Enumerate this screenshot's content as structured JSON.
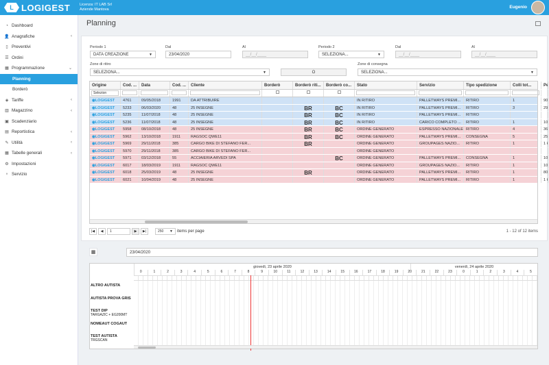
{
  "header": {
    "logo_letter": "L",
    "logo": "LOGIGEST",
    "license": "Licenza: IT LAB Srl",
    "company": "Aziende Mantova",
    "user": "Eugenio"
  },
  "sidebar": [
    {
      "label": "Dashboard",
      "icon": "dashboard-icon",
      "glyph": "◔"
    },
    {
      "label": "Anagrafiche",
      "icon": "users-icon",
      "glyph": "👤",
      "chev": "‹"
    },
    {
      "label": "Preventivi",
      "icon": "file-icon",
      "glyph": "▯"
    },
    {
      "label": "Ordini",
      "icon": "list-icon",
      "glyph": "☰"
    },
    {
      "label": "Programmazione",
      "icon": "calendar-icon",
      "glyph": "▦",
      "chev": "⌄"
    },
    {
      "label": "Planning",
      "sub": true,
      "active": true
    },
    {
      "label": "Borderò",
      "sub": true
    },
    {
      "label": "Tariffe",
      "icon": "tag-icon",
      "glyph": "◈",
      "chev": "‹"
    },
    {
      "label": "Magazzino",
      "icon": "warehouse-icon",
      "glyph": "▥",
      "chev": "‹"
    },
    {
      "label": "Scadenziario",
      "icon": "clock-icon",
      "glyph": "▣"
    },
    {
      "label": "Reportistica",
      "icon": "chart-icon",
      "glyph": "▤",
      "chev": "‹"
    },
    {
      "label": "Utilità",
      "icon": "tools-icon",
      "glyph": "✎",
      "chev": "‹"
    },
    {
      "label": "Tabelle generali",
      "icon": "table-icon",
      "glyph": "▦",
      "chev": "‹"
    },
    {
      "label": "Impostazioni",
      "icon": "settings-icon",
      "glyph": "⚙"
    },
    {
      "label": "Servizio",
      "icon": "service-icon",
      "glyph": "♆"
    }
  ],
  "page": {
    "title": "Planning"
  },
  "filters": {
    "periodo1_label": "Periodo 1",
    "periodo1_value": "DATA CREAZIONE",
    "dal1_label": "Dal",
    "dal1_value": "23/04/2020",
    "al1_label": "Al",
    "al1_value": "__/__/____",
    "periodo2_label": "Periodo 2",
    "periodo2_value": "SELEZIONA...",
    "dal2_label": "Dal",
    "dal2_value": "__/__/____",
    "al2_label": "Al",
    "al2_value": "__/__/____",
    "zone_ritiro_label": "Zone di ritiro",
    "zone_ritiro_value": "SELEZIONA...",
    "o_value": "O",
    "zone_consegna_label": "Zone di consegna",
    "zone_consegna_value": "SELEZIONA..."
  },
  "grid": {
    "columns": [
      "Origine",
      "Cod. ...",
      "Data",
      "Cod. ...",
      "Cliente",
      "Borderò",
      "Borderò riti...",
      "Borderò co...",
      "Stato",
      "Servizio",
      "Tipo spedizione",
      "Colli tot...",
      "Pe"
    ],
    "origin_filter": "Selezion",
    "rows": [
      {
        "c": "blue",
        "o": "LOGIGEST",
        "cod": "4761",
        "data": "09/05/2018",
        "cod2": "1991",
        "cli": "DA ATTRIBUIRE",
        "br": "",
        "bc": "",
        "stato": "IN RITIRO",
        "serv": "PALLETWAYS PREMI...",
        "tipo": "RITIRO",
        "colli": "1",
        "pe": "900 kg"
      },
      {
        "c": "blue",
        "o": "LOGIGEST",
        "cod": "5233",
        "data": "06/03/2020",
        "cod2": "48",
        "cli": "25 INSEGNE",
        "br": "BR",
        "bc": "BC",
        "stato": "IN RITIRO",
        "serv": "PALLETWAYS PREMI...",
        "tipo": "RITIRO",
        "colli": "3",
        "pe": "290 kg"
      },
      {
        "c": "blue",
        "o": "LOGIGEST",
        "cod": "5235",
        "data": "11/07/2018",
        "cod2": "48",
        "cli": "25 INSEGNE",
        "br": "BR",
        "bc": "BC",
        "stato": "IN RITIRO",
        "serv": "PALLETWAYS PREMI...",
        "tipo": "RITIRO",
        "colli": "",
        "pe": ""
      },
      {
        "c": "blue",
        "o": "LOGIGEST",
        "cod": "5236",
        "data": "11/07/2018",
        "cod2": "48",
        "cli": "25 INSEGNE",
        "br": "BR",
        "bc": "BC",
        "stato": "IN RITIRO",
        "serv": "CARICO COMPLETO ...",
        "tipo": "RITIRO",
        "colli": "1",
        "pe": "100 kg"
      },
      {
        "c": "red",
        "o": "LOGIGEST",
        "cod": "5958",
        "data": "08/10/2018",
        "cod2": "48",
        "cli": "25 INSEGNE",
        "br": "BR",
        "bc": "BC",
        "stato": "ORDINE GENERATO",
        "serv": "ESPRESSO NAZIONALE",
        "tipo": "RITIRO",
        "colli": "4",
        "pe": "36 kg"
      },
      {
        "c": "red",
        "o": "LOGIGEST",
        "cod": "5962",
        "data": "13/10/2018",
        "cod2": "1911",
        "cli": "RAGSOC QWE11",
        "br": "BR",
        "bc": "BC",
        "stato": "ORDINE GENERATO",
        "serv": "PALLETWAYS PREMI...",
        "tipo": "CONSEGNA",
        "colli": "5",
        "pe": "251 kg"
      },
      {
        "c": "red",
        "o": "LOGIGEST",
        "cod": "5969",
        "data": "29/11/2018",
        "cod2": "385",
        "cli": "CARGO BIKE DI STEFANO FER...",
        "br": "BR",
        "bc": "",
        "stato": "ORDINE GENERATO",
        "serv": "GROUPAGES NAZIO...",
        "tipo": "RITIRO",
        "colli": "1",
        "pe": "1 kg"
      },
      {
        "c": "red",
        "o": "LOGIGEST",
        "cod": "5970",
        "data": "29/11/2018",
        "cod2": "385",
        "cli": "CARGO BIKE DI STEFANO FER...",
        "br": "",
        "bc": "",
        "stato": "ORDINE GENERATO",
        "serv": "",
        "tipo": "",
        "colli": "",
        "pe": ""
      },
      {
        "c": "red",
        "o": "LOGIGEST",
        "cod": "5971",
        "data": "03/12/2018",
        "cod2": "55",
        "cli": "ACCIAIERIA ARVEDI SPA",
        "br": "",
        "bc": "BC",
        "stato": "ORDINE GENERATO",
        "serv": "PALLETWAYS PREMI...",
        "tipo": "CONSEGNA",
        "colli": "1",
        "pe": "105 kg"
      },
      {
        "c": "red",
        "o": "LOGIGEST",
        "cod": "6017",
        "data": "18/03/2019",
        "cod2": "1911",
        "cli": "RAGSOC QWE11",
        "br": "",
        "bc": "",
        "stato": "ORDINE GENERATO",
        "serv": "GROUPAGES NAZIO...",
        "tipo": "RITIRO",
        "colli": "1",
        "pe": "100 kg"
      },
      {
        "c": "red",
        "o": "LOGIGEST",
        "cod": "6018",
        "data": "25/03/2019",
        "cod2": "48",
        "cli": "25 INSEGNE",
        "br": "BR",
        "bc": "",
        "stato": "ORDINE GENERATO",
        "serv": "PALLETWAYS PREMI...",
        "tipo": "RITIRO",
        "colli": "1",
        "pe": "800 kg"
      },
      {
        "c": "red",
        "o": "LOGIGEST",
        "cod": "6021",
        "data": "10/04/2019",
        "cod2": "48",
        "cli": "25 INSEGNE",
        "br": "",
        "bc": "",
        "stato": "ORDINE GENERATO",
        "serv": "PALLETWAYS PREMI...",
        "tipo": "RITIRO",
        "colli": "1",
        "pe": "1 kg"
      }
    ],
    "pager": {
      "first": "|◀",
      "prev": "◀",
      "page": "1",
      "next": "▶",
      "last": "▶|",
      "size": "250",
      "per_page": "items per page",
      "count": "1 - 12 of 12 items"
    }
  },
  "schedule": {
    "date": "23/04/2020",
    "day1": "giovedì, 23 aprile 2020",
    "day2": "venerdì, 24 aprile 2020",
    "hours": [
      "0",
      "1",
      "2",
      "3",
      "4",
      "5",
      "6",
      "7",
      "8",
      "9",
      "10",
      "11",
      "12",
      "13",
      "14",
      "15",
      "16",
      "17",
      "18",
      "19",
      "20",
      "21",
      "22",
      "23",
      "0",
      "1",
      "2",
      "3",
      "4",
      "5"
    ],
    "resources": [
      {
        "name": "ALTRO AUTISTA",
        "sub": ""
      },
      {
        "name": "AUTISTA PROVA GRIS",
        "sub": ""
      },
      {
        "name": "TEST DIP",
        "sub": "TARGAZIC + EG200MT"
      },
      {
        "name": "NOMEAUT COGAUT",
        "sub": ""
      },
      {
        "name": "TEST AUTISTA",
        "sub": "TRGSCAN"
      }
    ]
  }
}
